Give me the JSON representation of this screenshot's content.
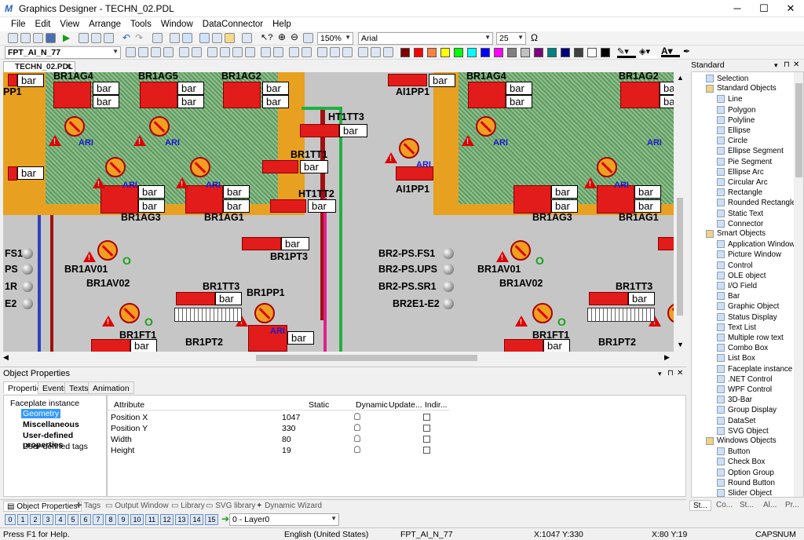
{
  "window": {
    "title": "Graphics Designer - TECHN_02.PDL",
    "minimize": "─",
    "maximize": "☐",
    "close": "✕"
  },
  "menu": [
    "File",
    "Edit",
    "View",
    "Arrange",
    "Tools",
    "Window",
    "DataConnector",
    "Help"
  ],
  "toolbar": {
    "zoom": "150%",
    "font": "Arial",
    "font_size": "25",
    "omega": "Ω",
    "object_name": "FPT_AI_N_77"
  },
  "colors": [
    "#800000",
    "#ff0000",
    "#ff8040",
    "#ffff00",
    "#00ff00",
    "#00ffff",
    "#0000ff",
    "#ff00ff",
    "#808080",
    "#c0c0c0",
    "#800080",
    "#008080",
    "#000080",
    "#404040",
    "#ffffff",
    "#000000"
  ],
  "document_tab": {
    "label": "TECHN_02.PDL"
  },
  "canvas": {
    "bar_text": "bar",
    "labels": [
      "BR1AG4",
      "BR1AG5",
      "BR1AG2",
      "HT1TT3",
      "BR1AG4",
      "BR1AG2",
      "BR1TT1",
      "HT1TT2",
      "BR1AG3",
      "BR1AG1",
      "AI1PP1",
      "BR1AG3",
      "BR1AG1",
      "BR1PT3",
      "FS1",
      "PS",
      "1R",
      "E2",
      "BR2-PS.FS1",
      "BR2-PS.UPS",
      "BR2-PS.SR1",
      "BR2E1-E2",
      "BR1AV01",
      "BR1AV02",
      "BR1TT3",
      "BR1PP1",
      "BR1FT1",
      "BR1PT2",
      "BR1AV01",
      "BR1AV02",
      "BR1TT3",
      "BR1FT1",
      "BR1PT2",
      "PP1",
      "AI1PP1"
    ],
    "ari": "ARI",
    "o_mark": "O"
  },
  "object_properties": {
    "title": "Object Properties",
    "tabs": [
      "Properties",
      "Events",
      "Texts",
      "Animation"
    ],
    "tree": {
      "root": "Faceplate instance",
      "items": [
        "Geometry",
        "Miscellaneous",
        "User-defined properties",
        "User-defined tags"
      ]
    },
    "columns": [
      "Attribute",
      "Static",
      "Dynamic",
      "Update...",
      "Indir..."
    ],
    "rows": [
      {
        "attribute": "Position X",
        "static": "1047"
      },
      {
        "attribute": "Position Y",
        "static": "330"
      },
      {
        "attribute": "Width",
        "static": "80"
      },
      {
        "attribute": "Height",
        "static": "19"
      }
    ]
  },
  "bottom_tabs": [
    "Object Properties",
    "Tags",
    "Output Window",
    "Library",
    "SVG library",
    "Dynamic Wizard"
  ],
  "layers": {
    "buttons": [
      "0",
      "1",
      "2",
      "3",
      "4",
      "5",
      "6",
      "7",
      "8",
      "9",
      "10",
      "11",
      "12",
      "13",
      "14",
      "15"
    ],
    "current": "0 - Layer0"
  },
  "palette": {
    "title": "Standard",
    "selection": "Selection",
    "groups": [
      {
        "name": "Standard Objects",
        "items": [
          "Line",
          "Polygon",
          "Polyline",
          "Ellipse",
          "Circle",
          "Ellipse Segment",
          "Pie Segment",
          "Ellipse Arc",
          "Circular Arc",
          "Rectangle",
          "Rounded Rectangle",
          "Static Text",
          "Connector"
        ]
      },
      {
        "name": "Smart Objects",
        "items": [
          "Application Window",
          "Picture Window",
          "Control",
          "OLE object",
          "I/O Field",
          "Bar",
          "Graphic Object",
          "Status Display",
          "Text List",
          "Multiple row text",
          "Combo Box",
          "List Box",
          "Faceplate instance",
          ".NET Control",
          "WPF Control",
          "3D-Bar",
          "Group Display",
          "DataSet",
          "SVG Object"
        ]
      },
      {
        "name": "Windows Objects",
        "items": [
          "Button",
          "Check Box",
          "Option Group",
          "Round Button",
          "Slider Object"
        ]
      }
    ],
    "tabs": [
      "St...",
      "Co...",
      "St...",
      "Al...",
      "Pr..."
    ]
  },
  "status": {
    "help": "Press F1 for Help.",
    "language": "English (United States)",
    "object": "FPT_AI_N_77",
    "pos": "X:1047 Y:330",
    "size": "X:80 Y:19",
    "caps": "CAPS",
    "num": "NUM"
  }
}
